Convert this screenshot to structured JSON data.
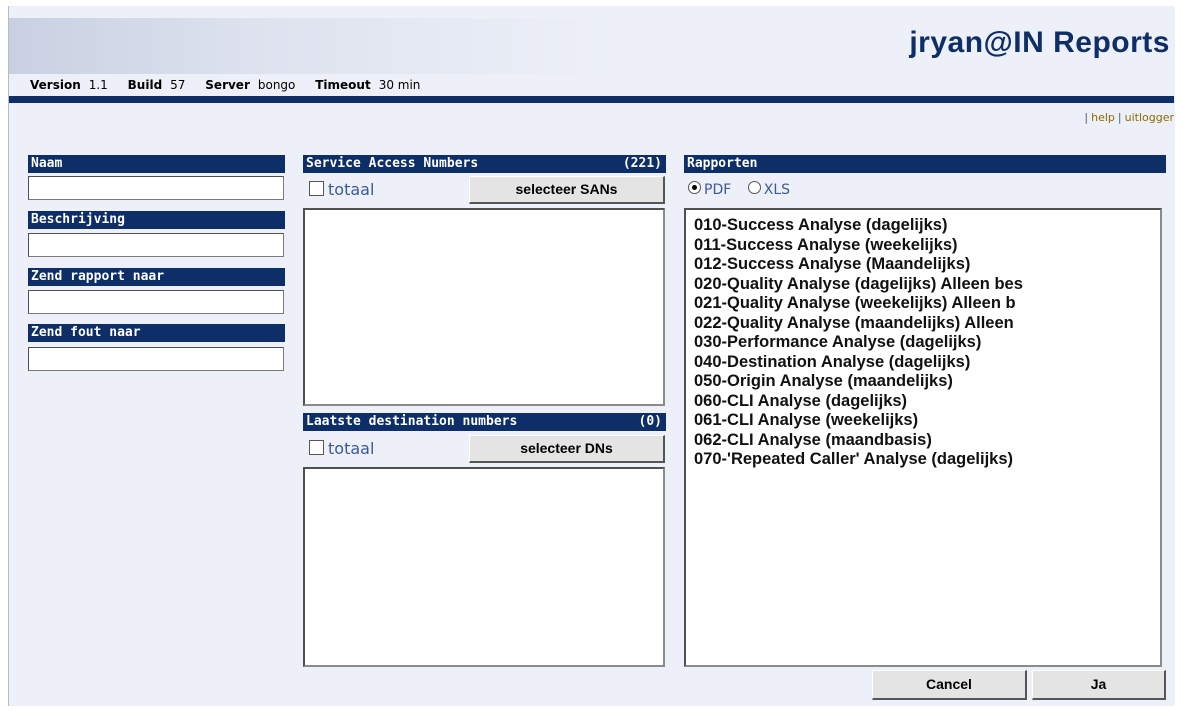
{
  "header": {
    "title": "jryan@IN Reports",
    "info": {
      "version_label": "Version",
      "version": "1.1",
      "build_label": "Build",
      "build": "57",
      "server_label": "Server",
      "server": "bongo",
      "timeout_label": "Timeout",
      "timeout": "30 min"
    },
    "links": {
      "help": "help",
      "logout": "uitlogger"
    }
  },
  "form": {
    "name_label": "Naam",
    "name_value": "",
    "description_label": "Beschrijving",
    "description_value": "",
    "send_report_label": "Zend rapport naar",
    "send_report_value": "",
    "send_error_label": "Zend fout naar",
    "send_error_value": ""
  },
  "san": {
    "header": "Service Access Numbers",
    "count": "(221)",
    "total_label": "totaal",
    "total_checked": false,
    "select_button": "selecteer SANs",
    "items": []
  },
  "dn": {
    "header": "Laatste destination numbers",
    "count": "(0)",
    "total_label": "totaal",
    "total_checked": false,
    "select_button": "selecteer DNs",
    "items": []
  },
  "reports": {
    "header": "Rapporten",
    "format_options": [
      "PDF",
      "XLS"
    ],
    "selected_format": "PDF",
    "items": [
      "010-Success Analyse (dagelijks)",
      "011-Success Analyse (weekelijks)",
      "012-Success Analyse (Maandelijks)",
      "020-Quality Analyse (dagelijks) Alleen bes",
      "021-Quality Analyse (weekelijks) Alleen b",
      "022-Quality Analyse (maandelijks) Alleen",
      "030-Performance Analyse (dagelijks)",
      "040-Destination Analyse (dagelijks)",
      "050-Origin Analyse (maandelijks)",
      "060-CLI Analyse (dagelijks)",
      "061-CLI Analyse (weekelijks)",
      "062-CLI Analyse (maandbasis)",
      "070-'Repeated Caller' Analyse (dagelijks)"
    ]
  },
  "actions": {
    "cancel": "Cancel",
    "ok": "Ja"
  },
  "colors": {
    "accent": "#0d2e66",
    "background": "#edf0f8",
    "link": "#8a6a00"
  }
}
